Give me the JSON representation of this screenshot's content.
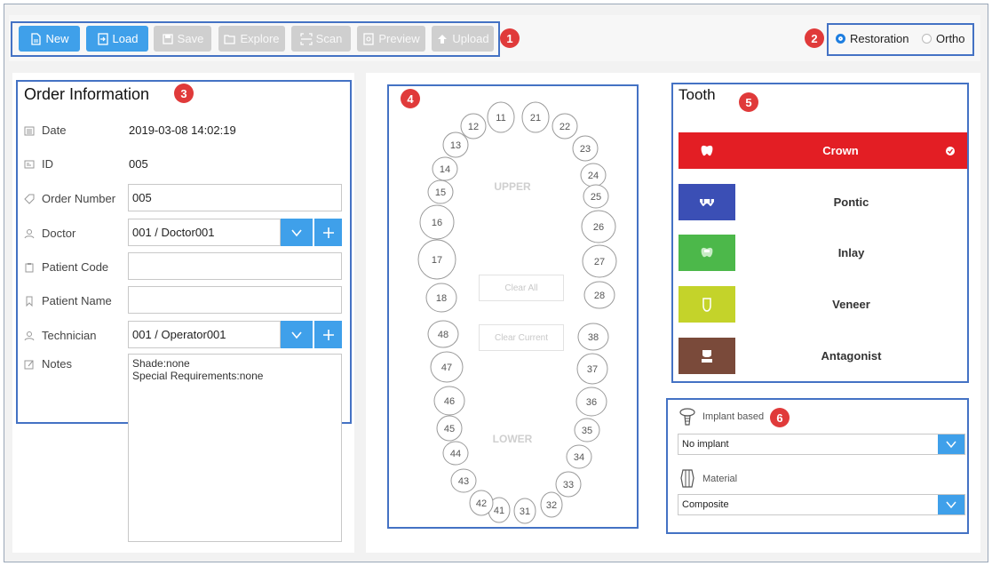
{
  "toolbar": {
    "buttons": [
      {
        "label": "New",
        "icon": "file-icon",
        "enabled": true
      },
      {
        "label": "Load",
        "icon": "load-icon",
        "enabled": true
      },
      {
        "label": "Save",
        "icon": "save-icon",
        "enabled": false
      },
      {
        "label": "Explore",
        "icon": "folder-icon",
        "enabled": false
      },
      {
        "label": "Scan",
        "icon": "scan-icon",
        "enabled": false
      },
      {
        "label": "Preview",
        "icon": "preview-icon",
        "enabled": false
      },
      {
        "label": "Upload",
        "icon": "upload-icon",
        "enabled": false
      }
    ]
  },
  "callouts": [
    "1",
    "2",
    "3",
    "4",
    "5",
    "6"
  ],
  "mode": {
    "options": [
      "Restoration",
      "Ortho"
    ],
    "selected": "Restoration"
  },
  "order": {
    "title": "Order Information",
    "date_label": "Date",
    "date_value": "2019-03-08 14:02:19",
    "id_label": "ID",
    "id_value": "005",
    "order_number_label": "Order Number",
    "order_number_value": "005",
    "doctor_label": "Doctor",
    "doctor_value": "001 / Doctor001",
    "patient_code_label": "Patient Code",
    "patient_code_value": "",
    "patient_name_label": "Patient Name",
    "patient_name_value": "",
    "technician_label": "Technician",
    "technician_value": "001 / Operator001",
    "notes_label": "Notes",
    "notes_value": "Shade:none\nSpecial Requirements:none"
  },
  "tooth_chart": {
    "upper_label": "UPPER",
    "lower_label": "LOWER",
    "clear_all": "Clear All",
    "clear_current": "Clear Current",
    "upper_teeth": [
      "11",
      "12",
      "13",
      "14",
      "15",
      "16",
      "17",
      "18",
      "21",
      "22",
      "23",
      "24",
      "25",
      "26",
      "27",
      "28"
    ],
    "lower_teeth": [
      "31",
      "32",
      "33",
      "34",
      "35",
      "36",
      "37",
      "38",
      "41",
      "42",
      "43",
      "44",
      "45",
      "46",
      "47",
      "48"
    ]
  },
  "tooth_types": {
    "title": "Tooth",
    "items": [
      {
        "label": "Crown",
        "color": "#e31e24",
        "icon": "crown-icon",
        "selected": true
      },
      {
        "label": "Pontic",
        "color": "#3b4fb5",
        "icon": "pontic-icon",
        "selected": false
      },
      {
        "label": "Inlay",
        "color": "#4cb84a",
        "icon": "inlay-icon",
        "selected": false
      },
      {
        "label": "Veneer",
        "color": "#c4d32a",
        "icon": "veneer-icon",
        "selected": false
      },
      {
        "label": "Antagonist",
        "color": "#7a4a3a",
        "icon": "antagonist-icon",
        "selected": false
      }
    ]
  },
  "implant": {
    "label": "Implant based",
    "value": "No implant",
    "material_label": "Material",
    "material_value": "Composite"
  },
  "colors": {
    "accent": "#3fa0ea",
    "callout_border": "#4472c4",
    "badge": "#e03a3a"
  }
}
